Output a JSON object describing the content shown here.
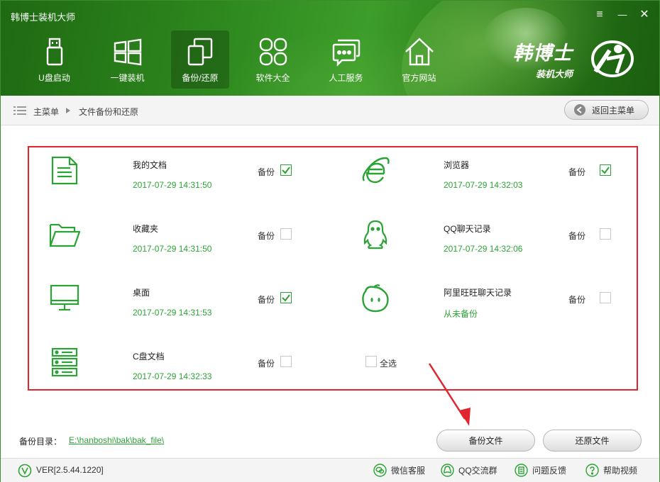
{
  "app": {
    "title": "韩博士装机大师"
  },
  "window_controls": {
    "menu": "≡",
    "minimize": "—",
    "close": "✕"
  },
  "nav": [
    {
      "label": "U盘启动",
      "icon": "usb-icon"
    },
    {
      "label": "一键装机",
      "icon": "windows-icon"
    },
    {
      "label": "备份/还原",
      "icon": "backup-restore-icon",
      "active": true
    },
    {
      "label": "软件大全",
      "icon": "apps-grid-icon"
    },
    {
      "label": "人工服务",
      "icon": "chat-icon"
    },
    {
      "label": "官方网站",
      "icon": "home-icon"
    }
  ],
  "brand": {
    "name": "韩博士",
    "subtitle": "装机大师"
  },
  "breadcrumb": {
    "root": "主菜单",
    "current": "文件备份和还原"
  },
  "back_button": "返回主菜单",
  "items": [
    {
      "name": "我的文档",
      "date": "2017-07-29 14:31:50",
      "backup_label": "备份",
      "checked": true,
      "icon": "document-icon"
    },
    {
      "name": "浏览器",
      "date": "2017-07-29 14:32:03",
      "backup_label": "备份",
      "checked": true,
      "icon": "ie-browser-icon"
    },
    {
      "name": "收藏夹",
      "date": "2017-07-29 14:31:50",
      "backup_label": "备份",
      "checked": false,
      "icon": "folder-icon"
    },
    {
      "name": "QQ聊天记录",
      "date": "2017-07-29 14:32:06",
      "backup_label": "备份",
      "checked": false,
      "icon": "qq-penguin-icon"
    },
    {
      "name": "桌面",
      "date": "2017-07-29 14:31:53",
      "backup_label": "备份",
      "checked": true,
      "icon": "monitor-icon"
    },
    {
      "name": "阿里旺旺聊天记录",
      "date": "从未备份",
      "backup_label": "备份",
      "checked": false,
      "icon": "wangwang-icon"
    },
    {
      "name": "C盘文档",
      "date": "2017-07-29 14:32:33",
      "backup_label": "备份",
      "checked": false,
      "icon": "server-drive-icon"
    }
  ],
  "select_all": {
    "label": "全选",
    "checked": false
  },
  "backup_dir": {
    "label": "备份目录：",
    "path": "E:\\hanboshi\\bak\\bak_file\\"
  },
  "buttons": {
    "backup": "备份文件",
    "restore": "还原文件"
  },
  "footer": {
    "version": "VER[2.5.44.1220]",
    "links": [
      {
        "label": "微信客服",
        "icon": "wechat-icon"
      },
      {
        "label": "QQ交流群",
        "icon": "qq-icon"
      },
      {
        "label": "问题反馈",
        "icon": "feedback-icon"
      },
      {
        "label": "帮助视频",
        "icon": "help-icon"
      }
    ]
  },
  "colors": {
    "accent_green": "#2ba334",
    "header_green": "#2f8a1f",
    "highlight_red": "#e0262f"
  }
}
